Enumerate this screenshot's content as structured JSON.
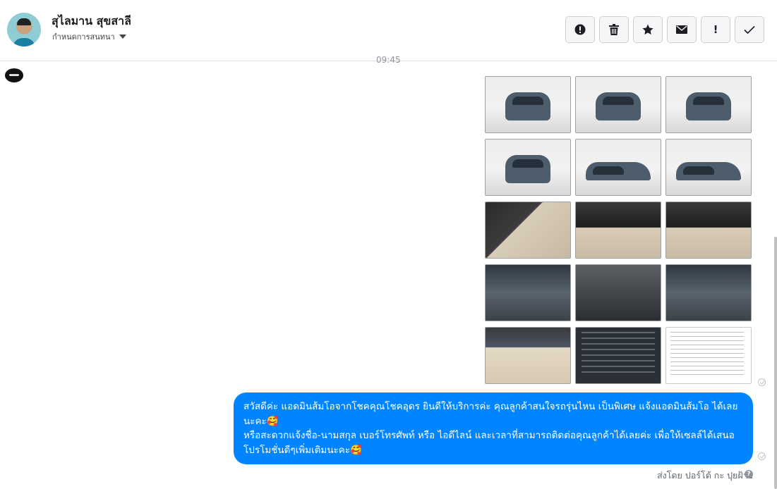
{
  "header": {
    "contact_name": "สุไลมาน สุขสาลี",
    "assign_label": "กำหนดการสนทนา"
  },
  "toolbar": {
    "buttons": [
      {
        "icon": "alert-circle-icon"
      },
      {
        "icon": "trash-icon"
      },
      {
        "icon": "star-icon"
      },
      {
        "icon": "envelope-icon"
      },
      {
        "label": "!",
        "icon": "exclamation-icon"
      },
      {
        "icon": "checkmark-icon"
      }
    ]
  },
  "conversation": {
    "timestamp": "09:45",
    "attachments": [
      {
        "kind": "car-front"
      },
      {
        "kind": "car-front-angle"
      },
      {
        "kind": "car-rear-angle"
      },
      {
        "kind": "car-rear"
      },
      {
        "kind": "car-side"
      },
      {
        "kind": "car-side"
      },
      {
        "kind": "door-interior"
      },
      {
        "kind": "dashboard-interior"
      },
      {
        "kind": "gear-shift"
      },
      {
        "kind": "engine-bay"
      },
      {
        "kind": "center-console"
      },
      {
        "kind": "engine-closeup"
      },
      {
        "kind": "rear-seat"
      },
      {
        "kind": "spec-screenshot"
      },
      {
        "kind": "post-screenshot"
      }
    ],
    "message": {
      "line1": "สวัสดีค่ะ แอดมินส้มโอจากโชคคุณโชคอุดร ยินดีให้บริการค่ะ   คุณลูกค้าสนใจรถรุ่นไหน เป็นพิเศษ แจ้งแอดมินส้มโอ ได้เลยนะคะ🥰",
      "line2": "หรือสะดวกแจ้งชื่อ-นามสกุล เบอร์โทรศัพท์ หรือ ไอดีไลน์ และเวลาที่สามารถติดต่อคุณลูกค้าได้เลยค่ะ เพื่อให้เซลล์ได้เสนอโปรโมชั่นดีๆเพิ่มเติมนะคะ🥰"
    },
    "sent_by": "ส่งโดย ปอร์โต้ กะ ปุยฝ้าย",
    "help_glyph": "?"
  },
  "colors": {
    "bubble": "#0084ff",
    "toolbar_bg": "#f5f6f7",
    "border": "#ccd0d5"
  }
}
